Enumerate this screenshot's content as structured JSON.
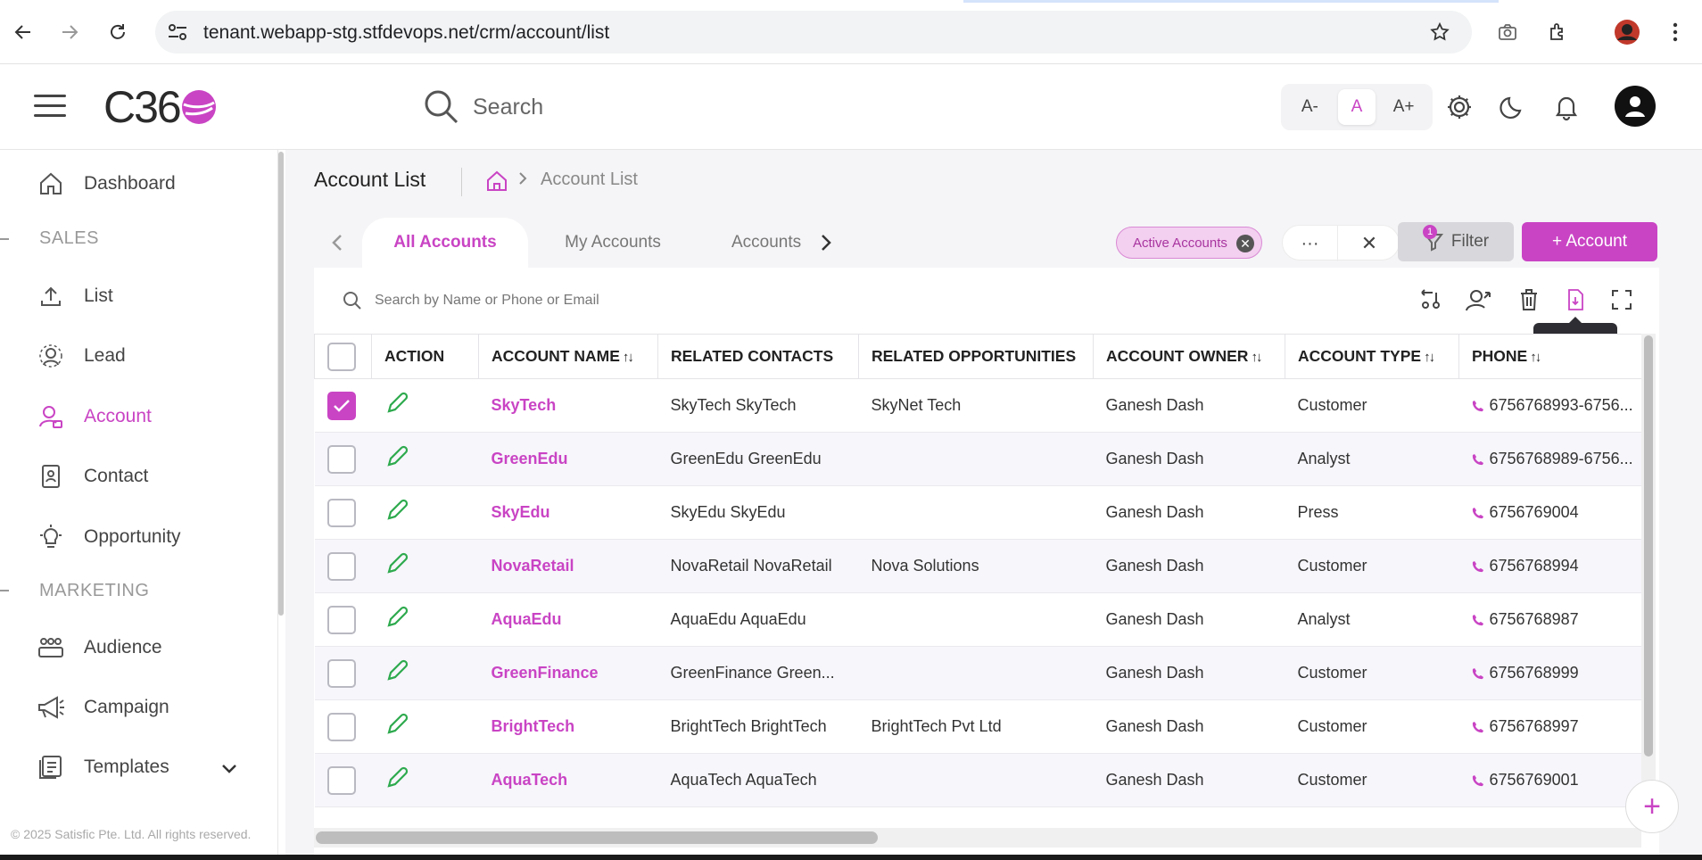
{
  "browser": {
    "url": "tenant.webapp-stg.stfdevops.net/crm/account/list"
  },
  "header": {
    "logo_text": "C36",
    "search_placeholder": "Search",
    "font_sizes": [
      "A-",
      "A",
      "A+"
    ],
    "active_font_size": "A"
  },
  "sidebar": {
    "items": [
      {
        "label": "Dashboard",
        "icon": "home-icon"
      },
      {
        "label": "List",
        "icon": "upload-icon"
      },
      {
        "label": "Lead",
        "icon": "lead-icon"
      },
      {
        "label": "Account",
        "icon": "account-icon"
      },
      {
        "label": "Contact",
        "icon": "contact-icon"
      },
      {
        "label": "Opportunity",
        "icon": "lightbulb-icon"
      },
      {
        "label": "Audience",
        "icon": "audience-icon"
      },
      {
        "label": "Campaign",
        "icon": "megaphone-icon"
      },
      {
        "label": "Templates",
        "icon": "templates-icon"
      }
    ],
    "sections": {
      "sales": "SALES",
      "marketing": "MARKETING"
    },
    "footer": "© 2025 Satisfic Pte. Ltd. All rights reserved."
  },
  "page": {
    "title": "Account List",
    "breadcrumb_current": "Account List"
  },
  "tabs": [
    {
      "label": "All Accounts",
      "active": true
    },
    {
      "label": "My Accounts",
      "active": false
    },
    {
      "label": "Accounts",
      "active": false
    }
  ],
  "toolbar": {
    "chip_label": "Active Accounts",
    "more_label": "···",
    "filter_label": "Filter",
    "filter_count": "1",
    "account_button_label": "+ Account",
    "search_placeholder": "Search by Name or Phone or Email",
    "download_tooltip": "Download"
  },
  "table": {
    "columns": [
      "ACTION",
      "ACCOUNT NAME",
      "RELATED CONTACTS",
      "RELATED OPPORTUNITIES",
      "ACCOUNT OWNER",
      "ACCOUNT TYPE",
      "PHONE"
    ],
    "rows": [
      {
        "checked": true,
        "name": "SkyTech",
        "contacts": "SkyTech SkyTech",
        "opportunities": "SkyNet Tech",
        "owner": "Ganesh Dash",
        "type": "Customer",
        "phone": "6756768993-6756..."
      },
      {
        "checked": false,
        "name": "GreenEdu",
        "contacts": "GreenEdu GreenEdu",
        "opportunities": "",
        "owner": "Ganesh Dash",
        "type": "Analyst",
        "phone": "6756768989-6756..."
      },
      {
        "checked": false,
        "name": "SkyEdu",
        "contacts": "SkyEdu SkyEdu",
        "opportunities": "",
        "owner": "Ganesh Dash",
        "type": "Press",
        "phone": "6756769004"
      },
      {
        "checked": false,
        "name": "NovaRetail",
        "contacts": "NovaRetail NovaRetail",
        "opportunities": "Nova Solutions",
        "owner": "Ganesh Dash",
        "type": "Customer",
        "phone": "6756768994"
      },
      {
        "checked": false,
        "name": "AquaEdu",
        "contacts": "AquaEdu AquaEdu",
        "opportunities": "",
        "owner": "Ganesh Dash",
        "type": "Analyst",
        "phone": "6756768987"
      },
      {
        "checked": false,
        "name": "GreenFinance",
        "contacts": "GreenFinance Green...",
        "opportunities": "",
        "owner": "Ganesh Dash",
        "type": "Customer",
        "phone": "6756768999"
      },
      {
        "checked": false,
        "name": "BrightTech",
        "contacts": "BrightTech BrightTech",
        "opportunities": "BrightTech Pvt Ltd",
        "owner": "Ganesh Dash",
        "type": "Customer",
        "phone": "6756768997"
      },
      {
        "checked": false,
        "name": "AquaTech",
        "contacts": "AquaTech AquaTech",
        "opportunities": "",
        "owner": "Ganesh Dash",
        "type": "Customer",
        "phone": "6756769001"
      }
    ]
  },
  "colors": {
    "accent": "#c944c4",
    "edit_icon": "#2eaa4e"
  }
}
